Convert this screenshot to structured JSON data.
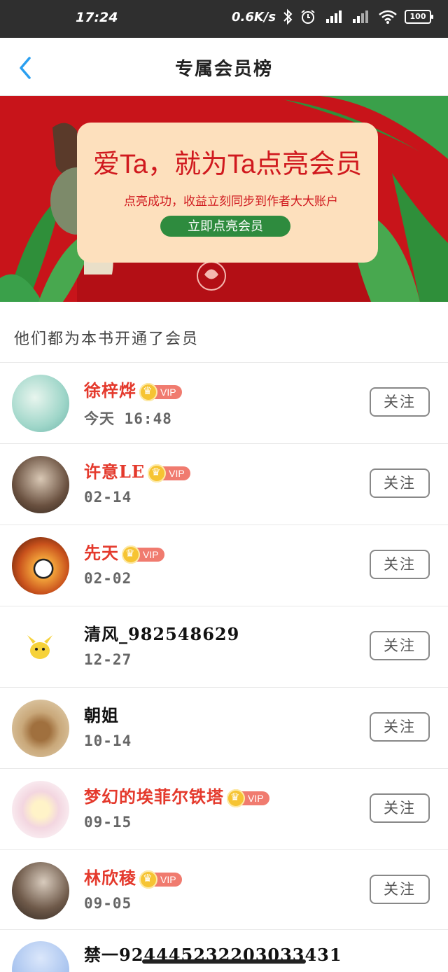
{
  "status_bar": {
    "time": "17:24",
    "net_speed": "0.6K/s",
    "battery": "100"
  },
  "header": {
    "title": "专属会员榜"
  },
  "banner": {
    "headline": "爱Ta，就为Ta点亮会员",
    "subtitle": "点亮成功，收益立刻同步到作者大大账户",
    "cta": "立即点亮会员"
  },
  "section_title": "他们都为本书开通了会员",
  "vip_label": "VIP",
  "follow_label": "关注",
  "members": [
    {
      "name": "徐梓烨",
      "date": "今天 16:48",
      "vip": true,
      "avatar_color": "#9fd6c9"
    },
    {
      "name": "许意LE",
      "date": "02-14",
      "vip": true,
      "avatar_color": "#6a5140"
    },
    {
      "name": "先天",
      "date": "02-02",
      "vip": true,
      "avatar_color": "#c9521c"
    },
    {
      "name": "清风_982548629",
      "date": "12-27",
      "vip": false,
      "avatar_color": "#ffffff"
    },
    {
      "name": "朝姐",
      "date": "10-14",
      "vip": false,
      "avatar_color": "#c9a87a"
    },
    {
      "name": "梦幻的埃菲尔铁塔",
      "date": "09-15",
      "vip": true,
      "avatar_color": "#f3d6e0"
    },
    {
      "name": "林欣稜",
      "date": "09-05",
      "vip": true,
      "avatar_color": "#6f5a4a"
    }
  ],
  "partial_member": {
    "name": "禁一924445232203033431",
    "avatar_color": "#a9c4ef"
  }
}
